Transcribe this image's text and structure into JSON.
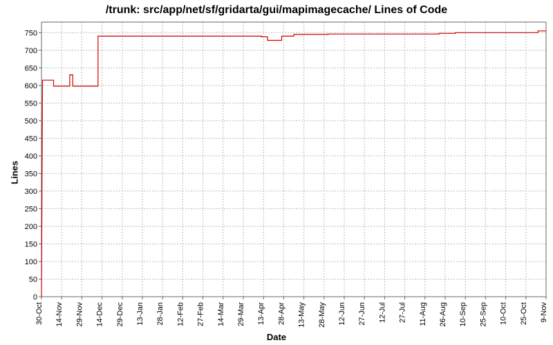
{
  "chart_data": {
    "type": "line",
    "title": "/trunk: src/app/net/sf/gridarta/gui/mapimagecache/ Lines of Code",
    "xlabel": "Date",
    "ylabel": "Lines",
    "ylim": [
      0,
      780
    ],
    "y_ticks": [
      0,
      50,
      100,
      150,
      200,
      250,
      300,
      350,
      400,
      450,
      500,
      550,
      600,
      650,
      700,
      750
    ],
    "x_categories": [
      "30-Oct",
      "14-Nov",
      "29-Nov",
      "14-Dec",
      "29-Dec",
      "13-Jan",
      "28-Jan",
      "12-Feb",
      "27-Feb",
      "14-Mar",
      "29-Mar",
      "13-Apr",
      "28-Apr",
      "13-May",
      "28-May",
      "12-Jun",
      "27-Jun",
      "12-Jul",
      "27-Jul",
      "11-Aug",
      "26-Aug",
      "10-Sep",
      "25-Sep",
      "10-Oct",
      "25-Oct",
      "9-Nov"
    ],
    "series": [
      {
        "name": "Lines of Code",
        "color": "#d00000",
        "points": [
          {
            "x": 0.0,
            "y": 0
          },
          {
            "x": 0.05,
            "y": 615
          },
          {
            "x": 0.6,
            "y": 615
          },
          {
            "x": 0.6,
            "y": 598
          },
          {
            "x": 1.4,
            "y": 598
          },
          {
            "x": 1.4,
            "y": 630
          },
          {
            "x": 1.55,
            "y": 630
          },
          {
            "x": 1.55,
            "y": 598
          },
          {
            "x": 2.8,
            "y": 598
          },
          {
            "x": 2.8,
            "y": 740
          },
          {
            "x": 10.9,
            "y": 740
          },
          {
            "x": 10.9,
            "y": 738
          },
          {
            "x": 11.2,
            "y": 738
          },
          {
            "x": 11.2,
            "y": 728
          },
          {
            "x": 11.9,
            "y": 728
          },
          {
            "x": 11.9,
            "y": 740
          },
          {
            "x": 12.5,
            "y": 740
          },
          {
            "x": 12.5,
            "y": 745
          },
          {
            "x": 14.2,
            "y": 745
          },
          {
            "x": 14.2,
            "y": 746
          },
          {
            "x": 19.7,
            "y": 746
          },
          {
            "x": 19.7,
            "y": 748
          },
          {
            "x": 20.5,
            "y": 748
          },
          {
            "x": 20.5,
            "y": 750
          },
          {
            "x": 24.6,
            "y": 750
          },
          {
            "x": 24.6,
            "y": 755
          },
          {
            "x": 25.0,
            "y": 755
          }
        ]
      }
    ]
  }
}
